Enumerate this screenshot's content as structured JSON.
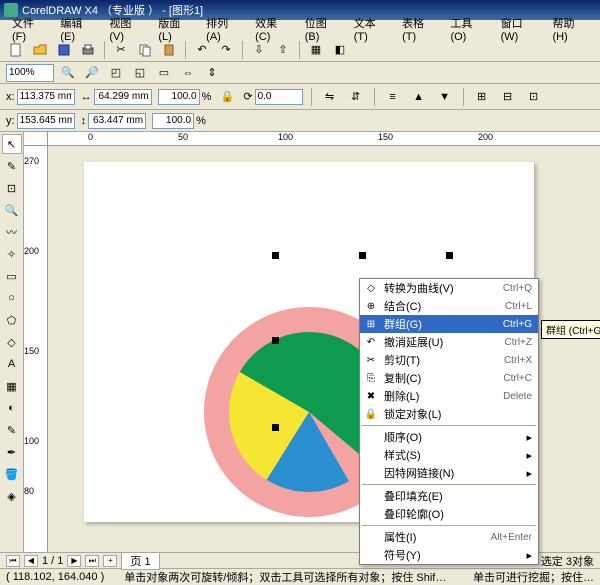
{
  "app": {
    "title": "CorelDRAW X4 （专业版 ） - [图形1]"
  },
  "menu": {
    "file": "文件(F)",
    "edit": "编辑(E)",
    "view": "视图(V)",
    "layout": "版面(L)",
    "arrange": "排列(A)",
    "effects": "效果(C)",
    "bitmaps": "位图(B)",
    "text": "文本(T)",
    "table": "表格(T)",
    "tools": "工具(O)",
    "window": "窗口(W)",
    "help": "帮助(H)"
  },
  "zoom": {
    "value": "100%"
  },
  "props": {
    "x_label": "x:",
    "x_value": "113.375 mm",
    "y_label": "y:",
    "y_value": "153.645 mm",
    "w_value": "64.299 mm",
    "h_value": "63.447 mm",
    "sx_value": "100.0",
    "sy_value": "100.0",
    "percent": "%",
    "angle_value": "0.0"
  },
  "ruler_h": {
    "t0": "0",
    "t1": "50",
    "t2": "100",
    "t3": "150",
    "t4": "200"
  },
  "ruler_v": {
    "t0": "270",
    "t1": "200",
    "t2": "150",
    "t3": "100",
    "t4": "80"
  },
  "context": {
    "convert": "转换为曲线(V)",
    "convert_sc": "Ctrl+Q",
    "combine": "结合(C)",
    "combine_sc": "Ctrl+L",
    "group": "群组(G)",
    "group_sc": "Ctrl+G",
    "undo": "撤消延展(U)",
    "undo_sc": "Ctrl+Z",
    "cut": "剪切(T)",
    "cut_sc": "Ctrl+X",
    "copy": "复制(C)",
    "copy_sc": "Ctrl+C",
    "delete": "删除(L)",
    "delete_sc": "Delete",
    "lock": "锁定对象(L)",
    "order": "顺序(O)",
    "style": "样式(S)",
    "link": "因特网链接(N)",
    "overfill": "叠印填充(E)",
    "overoutline": "叠印轮廓(O)",
    "properties": "属性(I)",
    "properties_sc": "Alt+Enter",
    "symbol": "符号(Y)"
  },
  "tooltip": "群组 (Ctrl+G)",
  "pagebar": {
    "info": "1 / 1",
    "tab": "页 1"
  },
  "status": {
    "selection": "选定 3对象",
    "hint": "单击对象两次可旋转/倾斜；双击工具可选择所有对象；按住 Shif…",
    "hint2": "单击可进行挖掘；按住…"
  },
  "coords": "( 118.102, 164.040 )"
}
